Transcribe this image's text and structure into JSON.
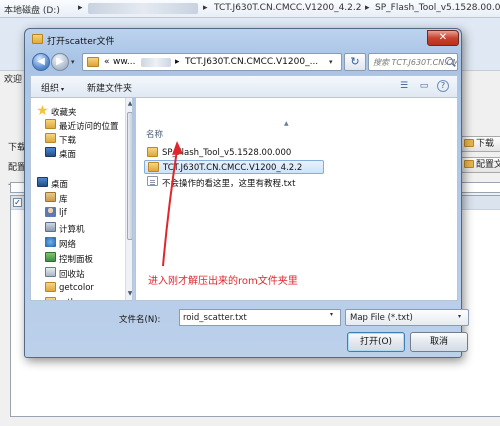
{
  "background": {
    "address": {
      "drive": "本地磁盘 (D:)",
      "folder1": "TCT.J630T.CN.CMCC.V1200_4.2.2",
      "folder2": "SP_Flash_Tool_v5.1528.00.000",
      "sep": "▸"
    },
    "tab_label": "欢迎",
    "left_labels": [
      "下载",
      "配置",
      "下载"
    ],
    "right_buttons": [
      "下载",
      "配置文"
    ]
  },
  "dialog": {
    "title": "打开scatter文件",
    "close_glyph": "✕",
    "nav": {
      "back_glyph": "◀",
      "forward_glyph": "▶",
      "drop_glyph": "▾",
      "address_prefix": "«",
      "address_part1": "ww...",
      "address_part2": "TCT.J630T.CN.CMCC.V1200_...",
      "address_sep": "▸",
      "refresh_glyph": "↻",
      "search_placeholder": "搜索 TCT.J630T.CN.CMCC.V..."
    },
    "command_bar": {
      "organize": "组织",
      "new_folder": "新建文件夹",
      "caret": "▾",
      "view_glyph": "☰",
      "pane_glyph": "▭",
      "help_glyph": "?"
    },
    "nav_pane": {
      "scroll_up": "▲",
      "scroll_down": "▼",
      "items": [
        {
          "label": "收藏夹",
          "icon": "star-icon"
        },
        {
          "label": "最近访问的位置",
          "icon": "recent-icon"
        },
        {
          "label": "下载",
          "icon": "folder-icon"
        },
        {
          "label": "桌面",
          "icon": "desktop-icon"
        },
        {
          "label": "桌面",
          "icon": "desktop-icon"
        },
        {
          "label": "库",
          "icon": "library-icon"
        },
        {
          "label": "ljf",
          "icon": "user-icon"
        },
        {
          "label": "计算机",
          "icon": "computer-icon"
        },
        {
          "label": "网络",
          "icon": "network-icon"
        },
        {
          "label": "控制面板",
          "icon": "control-panel-icon"
        },
        {
          "label": "回收站",
          "icon": "recycle-bin-icon"
        },
        {
          "label": "getcolor",
          "icon": "folder-icon"
        },
        {
          "label": "mtk",
          "icon": "folder-icon"
        }
      ]
    },
    "file_pane": {
      "column_name": "名称",
      "sort_caret": "▲",
      "files": [
        {
          "name": "SP_Flash_Tool_v5.1528.00.000",
          "type": "folder"
        },
        {
          "name": "TCT.J630T.CN.CMCC.V1200_4.2.2",
          "type": "folder",
          "selected": true
        },
        {
          "name": "不会操作的看这里，这里有教程.txt",
          "type": "text"
        }
      ]
    },
    "annotation": "进入刚才解压出来的rom文件夹里",
    "filename_label": "文件名(N):",
    "filename_value": "roid_scatter.txt",
    "filter_value": "Map File (*.txt)",
    "open_button": "打开(O)",
    "cancel_button": "取消"
  }
}
